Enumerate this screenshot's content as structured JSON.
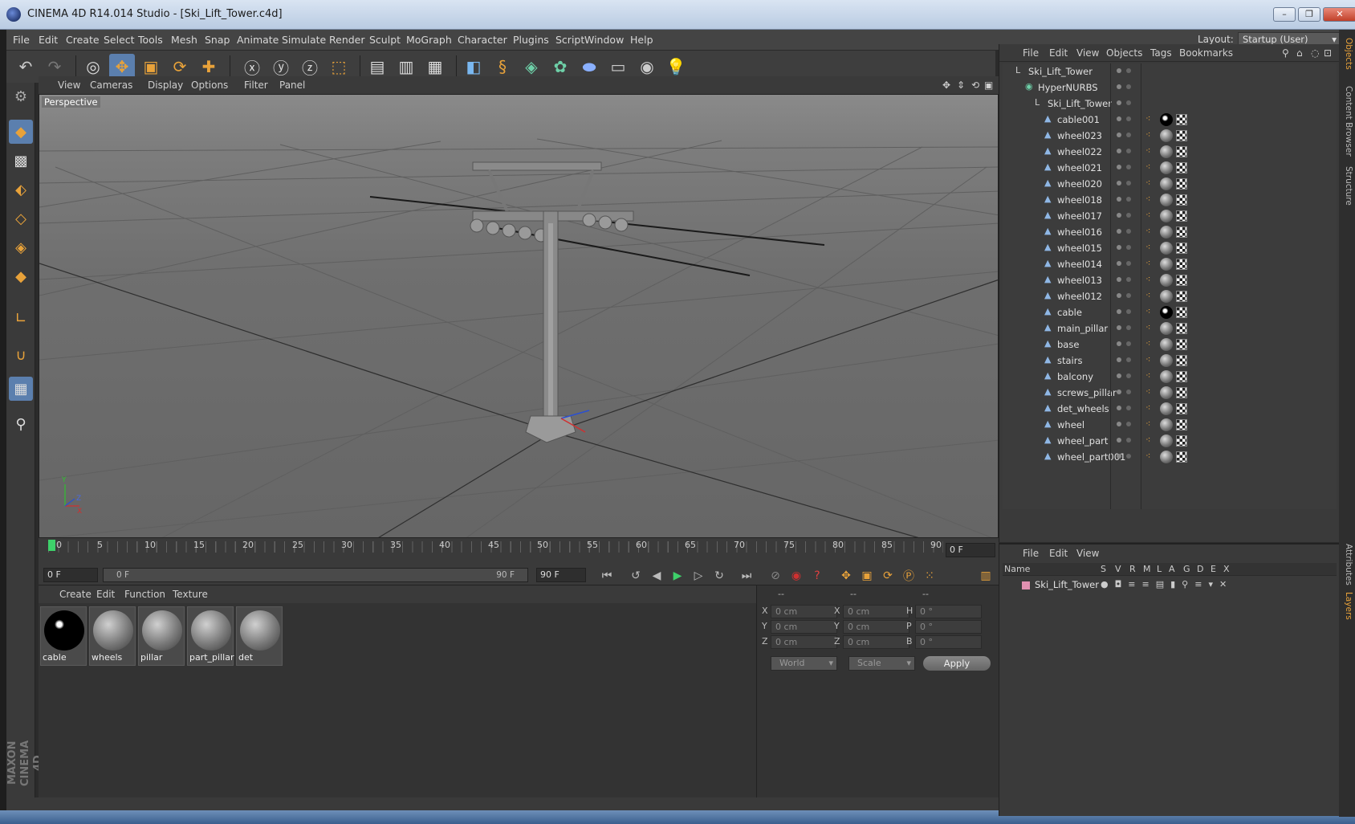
{
  "window": {
    "title": "CINEMA 4D R14.014 Studio - [Ski_Lift_Tower.c4d]",
    "buttons": [
      "–",
      "❐",
      "✕"
    ]
  },
  "menubar": {
    "items": [
      "File",
      "Edit",
      "Create",
      "Select",
      "Tools",
      "Mesh",
      "Snap",
      "Animate",
      "Simulate",
      "Render",
      "Sculpt",
      "MoGraph",
      "Character",
      "Plugins",
      "Script",
      "Window",
      "Help"
    ],
    "layout_label": "Layout:",
    "layout_value": "Startup (User)"
  },
  "viewport": {
    "menu": [
      "View",
      "Cameras",
      "Display",
      "Options",
      "Filter",
      "Panel"
    ],
    "label": "Perspective",
    "axis_labels": [
      "Y",
      "Z",
      "X"
    ]
  },
  "timeline": {
    "ticks": [
      "0",
      "5",
      "10",
      "15",
      "20",
      "25",
      "30",
      "35",
      "40",
      "45",
      "50",
      "55",
      "60",
      "65",
      "70",
      "75",
      "80",
      "85",
      "90"
    ],
    "current_frame": "0 F"
  },
  "transport": {
    "start_frame": "0 F",
    "slider_start": "0 F",
    "slider_end": "90 F",
    "end_frame": "90 F"
  },
  "materials": {
    "menu": [
      "Create",
      "Edit",
      "Function",
      "Texture"
    ],
    "items": [
      {
        "name": "cable",
        "style": "black"
      },
      {
        "name": "wheels",
        "style": "grey"
      },
      {
        "name": "pillar",
        "style": "grey"
      },
      {
        "name": "part_pillar",
        "style": "grey"
      },
      {
        "name": "det",
        "style": "grey"
      }
    ]
  },
  "attributes": {
    "headers": [
      "--",
      "--",
      "--"
    ],
    "rows": [
      {
        "l1": "X",
        "v1": "0 cm",
        "l2": "X",
        "v2": "0 cm",
        "l3": "H",
        "v3": "0 °"
      },
      {
        "l1": "Y",
        "v1": "0 cm",
        "l2": "Y",
        "v2": "0 cm",
        "l3": "P",
        "v3": "0 °"
      },
      {
        "l1": "Z",
        "v1": "0 cm",
        "l2": "Z",
        "v2": "0 cm",
        "l3": "B",
        "v3": "0 °"
      }
    ],
    "coord_system": "World",
    "mode": "Scale",
    "apply": "Apply"
  },
  "objects": {
    "menu": [
      "File",
      "Edit",
      "View",
      "Objects",
      "Tags",
      "Bookmarks"
    ],
    "tree": [
      {
        "name": "Ski_Lift_Tower",
        "depth": 0,
        "icon": "null-icon"
      },
      {
        "name": "HyperNURBS",
        "depth": 1,
        "icon": "hypernurbs-icon"
      },
      {
        "name": "Ski_Lift_Tower",
        "depth": 2,
        "icon": "null-icon"
      },
      {
        "name": "cable001",
        "depth": 3,
        "icon": "polygon-icon",
        "tag": "black"
      },
      {
        "name": "wheel023",
        "depth": 3,
        "icon": "polygon-icon",
        "tag": "grey"
      },
      {
        "name": "wheel022",
        "depth": 3,
        "icon": "polygon-icon",
        "tag": "grey"
      },
      {
        "name": "wheel021",
        "depth": 3,
        "icon": "polygon-icon",
        "tag": "grey"
      },
      {
        "name": "wheel020",
        "depth": 3,
        "icon": "polygon-icon",
        "tag": "grey"
      },
      {
        "name": "wheel018",
        "depth": 3,
        "icon": "polygon-icon",
        "tag": "grey"
      },
      {
        "name": "wheel017",
        "depth": 3,
        "icon": "polygon-icon",
        "tag": "grey"
      },
      {
        "name": "wheel016",
        "depth": 3,
        "icon": "polygon-icon",
        "tag": "grey"
      },
      {
        "name": "wheel015",
        "depth": 3,
        "icon": "polygon-icon",
        "tag": "grey"
      },
      {
        "name": "wheel014",
        "depth": 3,
        "icon": "polygon-icon",
        "tag": "grey"
      },
      {
        "name": "wheel013",
        "depth": 3,
        "icon": "polygon-icon",
        "tag": "grey"
      },
      {
        "name": "wheel012",
        "depth": 3,
        "icon": "polygon-icon",
        "tag": "grey"
      },
      {
        "name": "cable",
        "depth": 3,
        "icon": "polygon-icon",
        "tag": "black"
      },
      {
        "name": "main_pillar",
        "depth": 3,
        "icon": "polygon-icon",
        "tag": "grey"
      },
      {
        "name": "base",
        "depth": 3,
        "icon": "polygon-icon",
        "tag": "grey"
      },
      {
        "name": "stairs",
        "depth": 3,
        "icon": "polygon-icon",
        "tag": "grey"
      },
      {
        "name": "balcony",
        "depth": 3,
        "icon": "polygon-icon",
        "tag": "grey"
      },
      {
        "name": "screws_pillar",
        "depth": 3,
        "icon": "polygon-icon",
        "tag": "grey"
      },
      {
        "name": "det_wheels",
        "depth": 3,
        "icon": "polygon-icon",
        "tag": "grey"
      },
      {
        "name": "wheel",
        "depth": 3,
        "icon": "polygon-icon",
        "tag": "grey"
      },
      {
        "name": "wheel_part",
        "depth": 3,
        "icon": "polygon-icon",
        "tag": "grey"
      },
      {
        "name": "wheel_part001",
        "depth": 3,
        "icon": "polygon-icon",
        "tag": "grey"
      }
    ]
  },
  "layers": {
    "menu": [
      "File",
      "Edit",
      "View"
    ],
    "columns": [
      "Name",
      "S",
      "V",
      "R",
      "M",
      "L",
      "A",
      "G",
      "D",
      "E",
      "X"
    ],
    "rows": [
      {
        "name": "Ski_Lift_Tower"
      }
    ]
  },
  "side_tabs": [
    "Objects",
    "Content Browser",
    "Structure",
    "Attributes",
    "Layers"
  ],
  "brand": "MAXON CINEMA 4D",
  "colors": {
    "accent": "#5b7fae",
    "tool_orange": "#e8a23a"
  }
}
